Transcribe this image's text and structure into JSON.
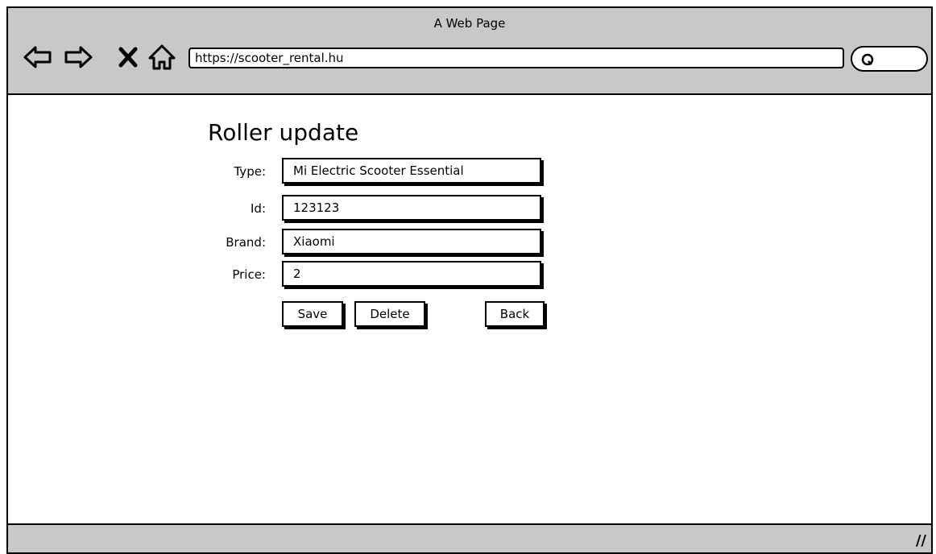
{
  "window": {
    "title": "A Web Page"
  },
  "browser": {
    "url": "https://scooter_rental.hu",
    "nav_icons": [
      "back-arrow-icon",
      "forward-arrow-icon",
      "stop-icon",
      "home-icon"
    ],
    "search_icon": "search-icon"
  },
  "form": {
    "heading": "Roller update",
    "fields": [
      {
        "label": "Type:",
        "value": "Mi Electric Scooter Essential"
      },
      {
        "label": "Id:",
        "value": "123123"
      },
      {
        "label": "Brand:",
        "value": "Xiaomi"
      },
      {
        "label": "Price:",
        "value": "2"
      }
    ],
    "buttons": {
      "save": "Save",
      "delete": "Delete",
      "back": "Back"
    }
  },
  "statusbar": {
    "grip_icon": "resize-grip-icon"
  }
}
